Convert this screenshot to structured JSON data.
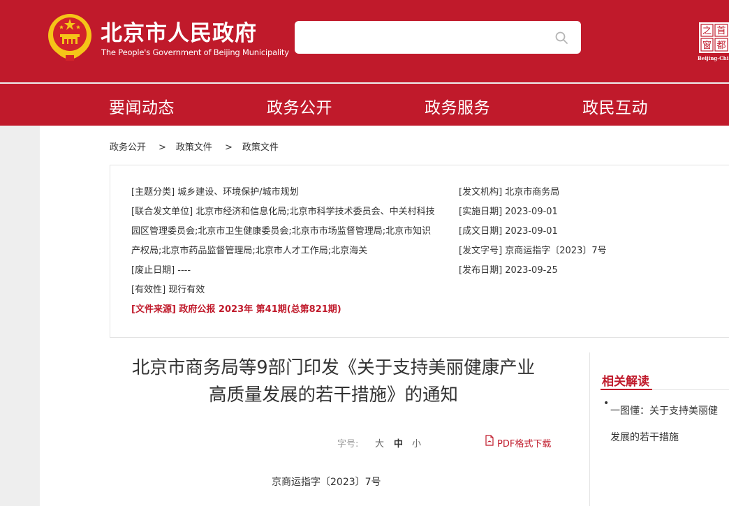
{
  "header": {
    "title_cn": "北京市人民政府",
    "title_en": "The People's Government of Beijing Municipality",
    "search_placeholder": ""
  },
  "nav": {
    "items": [
      "要闻动态",
      "政务公开",
      "政务服务",
      "政民互动"
    ]
  },
  "breadcrumb": [
    "政务公开",
    "政策文件",
    "政策文件"
  ],
  "breadcrumb_separator": ">",
  "info": {
    "theme": "[主题分类] 城乡建设、环境保护/城市规划",
    "joint_line1": "[联合发文单位] 北京市经济和信息化局;北京市科学技术委员会、中关村科技",
    "joint_line2": "园区管理委员会;北京市卫生健康委员会;北京市市场监督管理局;北京市知识",
    "joint_line3": "产权局;北京市药品监督管理局;北京市人才工作局;北京海关",
    "abolish_date": "[废止日期] ----",
    "validity": "[有效性] 现行有效",
    "source": "[文件来源] 政府公报 2023年 第41期(总第821期)",
    "issuer": "[发文机构] 北京市商务局",
    "impl_date": "[实施日期] 2023-09-01",
    "written_date": "[成文日期] 2023-09-01",
    "doc_no": "[发文字号] 京商运指字〔2023〕7号",
    "publish_date": "[发布日期] 2023-09-25"
  },
  "article": {
    "title_line1": "北京市商务局等9部门印发《关于支持美丽健康产业",
    "title_line2": "高质量发展的若干措施》的通知",
    "font_size_label": "字号:",
    "font_large": "大",
    "font_medium": "中",
    "font_small": "小",
    "pdf_label": "PDF格式下载",
    "doc_number": "京商运指字〔2023〕7号"
  },
  "related": {
    "title": "相关解读",
    "bullet": "•",
    "items": [
      "一图懂：关于支持美丽健康产业高质量发展的若干措施"
    ],
    "item_line1": "一图懂：关于支持美丽健",
    "item_line2": "发展的若干措施"
  },
  "window_logo": {
    "chars": [
      "之",
      "首",
      "窗",
      "都"
    ],
    "caption": "Beijing-Chi"
  },
  "colors": {
    "brand_red": "#c01a2b",
    "emblem_gold": "#f5c518"
  }
}
